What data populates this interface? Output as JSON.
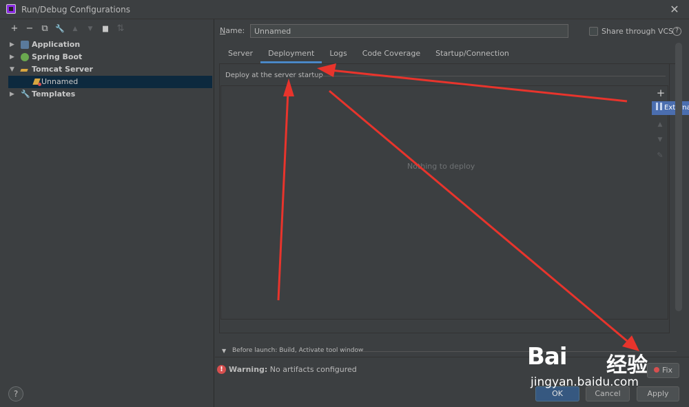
{
  "window": {
    "title": "Run/Debug Configurations",
    "close_glyph": "✕"
  },
  "left_toolbar": {
    "items": [
      {
        "name": "add-button",
        "glyph": "+",
        "enabled": true
      },
      {
        "name": "remove-button",
        "glyph": "−",
        "enabled": true
      },
      {
        "name": "copy-button",
        "glyph": "⧉",
        "enabled": true
      },
      {
        "name": "edit-defaults-button",
        "glyph": "🔧",
        "enabled": true
      },
      {
        "name": "move-up-button",
        "glyph": "▲",
        "enabled": false
      },
      {
        "name": "move-down-button",
        "glyph": "▼",
        "enabled": false
      },
      {
        "name": "folder-button",
        "glyph": "▆",
        "enabled": true
      },
      {
        "name": "sort-button",
        "glyph": "⇅",
        "enabled": false
      }
    ]
  },
  "tree": {
    "items": [
      {
        "label": "Application",
        "expanded": false,
        "icon": "application-icon"
      },
      {
        "label": "Spring Boot",
        "expanded": false,
        "icon": "spring-boot-icon"
      },
      {
        "label": "Tomcat Server",
        "expanded": true,
        "icon": "tomcat-icon"
      },
      {
        "label": "Unnamed",
        "child": true,
        "selected": true,
        "icon": "tomcat-run-config-icon"
      },
      {
        "label": "Templates",
        "expanded": false,
        "icon": "wrench-icon"
      }
    ]
  },
  "form": {
    "name_label_prefix": "N",
    "name_label_rest": "ame:",
    "name_value": "Unnamed",
    "share_label": "Share through VCS",
    "share_checked": false,
    "help_glyph": "?"
  },
  "tabs": [
    {
      "label": "Server",
      "active": false
    },
    {
      "label": "Deployment",
      "active": true
    },
    {
      "label": "Logs",
      "active": false
    },
    {
      "label": "Code Coverage",
      "active": false
    },
    {
      "label": "Startup/Connection",
      "active": false
    }
  ],
  "deployment": {
    "section_title": "Deploy at the server startup",
    "empty_text": "Nothing to deploy",
    "add_glyph": "+",
    "popup_item": "External Source..."
  },
  "before_launch": {
    "text": "Before launch: Build, Activate tool window"
  },
  "warning": {
    "icon_glyph": "!",
    "bold": "Warning:",
    "text": "No artifacts configured"
  },
  "buttons": {
    "fix": "Fix",
    "ok": "OK",
    "cancel": "Cancel",
    "apply": "Apply",
    "help": "?"
  },
  "watermark": {
    "brand": "Bai",
    "cn": "经验",
    "url": "jingyan.baidu.com"
  },
  "colors": {
    "background": "#3c3f41",
    "selection": "#0d293e",
    "accent": "#4a88c7",
    "annotation_arrow": "#e8342c",
    "warning": "#d64f4f"
  }
}
